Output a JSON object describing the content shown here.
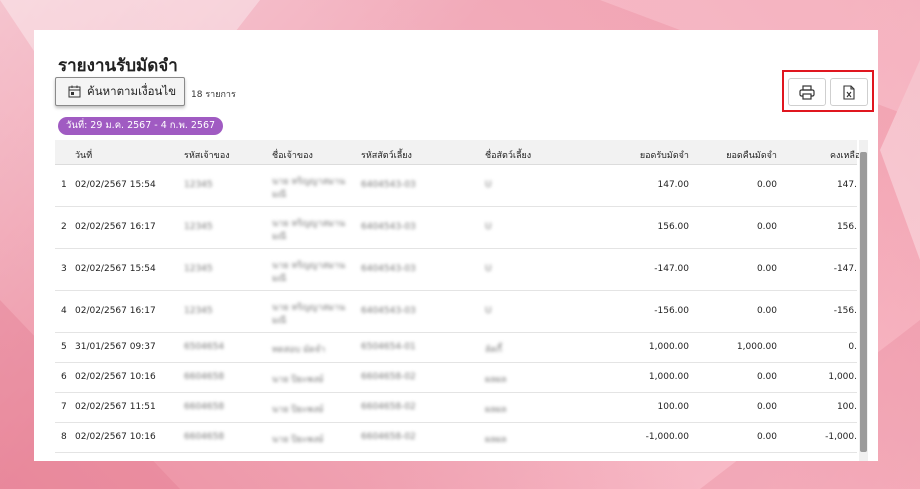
{
  "page": {
    "title": "รายงานรับมัดจำ",
    "search_button_label": "ค้นหาตามเงื่อนไข",
    "record_count": "18 รายการ",
    "date_range": "วันที่: 29 ม.ค. 2567 - 4 ก.พ. 2567"
  },
  "toolbar": {
    "print_icon": "printer-icon",
    "export_icon": "excel-file-icon",
    "highlight_color": "#e0161f"
  },
  "table": {
    "headers": [
      "วันที่",
      "รหัสเจ้าของ",
      "ชื่อเจ้าของ",
      "รหัสสัตว์เลี้ยง",
      "ชื่อสัตว์เลี้ยง",
      "ยอดรับมัดจำ",
      "ยอดคืนมัดจำ",
      "คงเหลือ"
    ],
    "rows": [
      {
        "no": "1",
        "date": "02/02/2567 15:54",
        "owner_code": "12345",
        "owner_name_1": "นาย หริญญาสมาน",
        "owner_name_2": "มณี",
        "pet_code": "6404543-03",
        "pet_name": "U",
        "received": "147.00",
        "returned": "0.00",
        "balance": "147."
      },
      {
        "no": "2",
        "date": "02/02/2567 16:17",
        "owner_code": "12345",
        "owner_name_1": "นาย หริญญาสมาน",
        "owner_name_2": "มณี",
        "pet_code": "6404543-03",
        "pet_name": "U",
        "received": "156.00",
        "returned": "0.00",
        "balance": "156."
      },
      {
        "no": "3",
        "date": "02/02/2567 15:54",
        "owner_code": "12345",
        "owner_name_1": "นาย หริญญาสมาน",
        "owner_name_2": "มณี",
        "pet_code": "6404543-03",
        "pet_name": "U",
        "received": "-147.00",
        "returned": "0.00",
        "balance": "-147."
      },
      {
        "no": "4",
        "date": "02/02/2567 16:17",
        "owner_code": "12345",
        "owner_name_1": "นาย หริญญาสมาน",
        "owner_name_2": "มณี",
        "pet_code": "6404543-03",
        "pet_name": "U",
        "received": "-156.00",
        "returned": "0.00",
        "balance": "-156."
      },
      {
        "no": "5",
        "date": "31/01/2567 09:37",
        "owner_code": "6504654",
        "owner_name_1": "ทดสอบ มัดจำ",
        "owner_name_2": "",
        "pet_code": "6504654-01",
        "pet_name": "ลัคกี้",
        "received": "1,000.00",
        "returned": "1,000.00",
        "balance": "0."
      },
      {
        "no": "6",
        "date": "02/02/2567 10:16",
        "owner_code": "6604658",
        "owner_name_1": "นาย ปิยะพงษ์",
        "owner_name_2": "",
        "pet_code": "6604658-02",
        "pet_name": "ผลผล",
        "received": "1,000.00",
        "returned": "0.00",
        "balance": "1,000."
      },
      {
        "no": "7",
        "date": "02/02/2567 11:51",
        "owner_code": "6604658",
        "owner_name_1": "นาย ปิยะพงษ์",
        "owner_name_2": "",
        "pet_code": "6604658-02",
        "pet_name": "ผลผล",
        "received": "100.00",
        "returned": "0.00",
        "balance": "100."
      },
      {
        "no": "8",
        "date": "02/02/2567 10:16",
        "owner_code": "6604658",
        "owner_name_1": "นาย ปิยะพงษ์",
        "owner_name_2": "",
        "pet_code": "6604658-02",
        "pet_name": "ผลผล",
        "received": "-1,000.00",
        "returned": "0.00",
        "balance": "-1,000."
      }
    ]
  }
}
